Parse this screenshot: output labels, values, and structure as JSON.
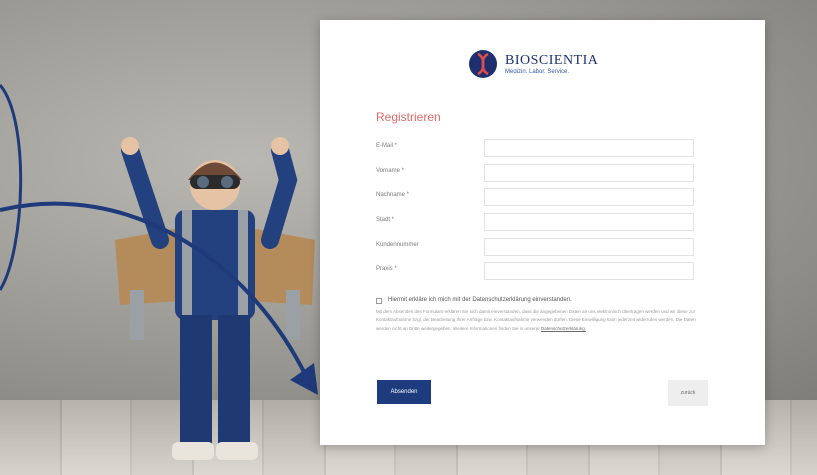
{
  "brand": {
    "name": "BIOSCIENTIA",
    "tagline": "Medizin. Labor. Service.",
    "color": "#1d2f6f"
  },
  "form": {
    "title": "Registrieren",
    "title_color": "#e06a6a",
    "fields": [
      {
        "label": "E-Mail *",
        "value": ""
      },
      {
        "label": "Vorname *",
        "value": ""
      },
      {
        "label": "Nachname *",
        "value": ""
      },
      {
        "label": "Stadt *",
        "value": ""
      },
      {
        "label": "Kundennummer",
        "value": ""
      },
      {
        "label": "Praxis *",
        "value": ""
      }
    ]
  },
  "consent": {
    "checked": false,
    "title": "Hiermit erkläre ich mich mit der Datenschutzerklärung einverstanden.",
    "body": "Mit dem Absenden des Formulars erklären Sie sich damit einverstanden, dass die angegebenen Daten an uns elektronisch übertragen werden und wir diese zur Kontaktaufnahme bzgl. der Bearbeitung Ihrer Anfrage bzw. Kontaktaufnahme verwenden dürfen. Diese Einwilligung kann jederzeit widerrufen werden. Die Daten werden nicht an Dritte weitergegeben. Weitere Informationen finden Sie in unserer",
    "link": "Datenschutzerklärung."
  },
  "buttons": {
    "submit": "Absenden",
    "back": "zurück"
  },
  "colors": {
    "primary": "#1d3b7d",
    "arrow": "#1f3a7a"
  }
}
